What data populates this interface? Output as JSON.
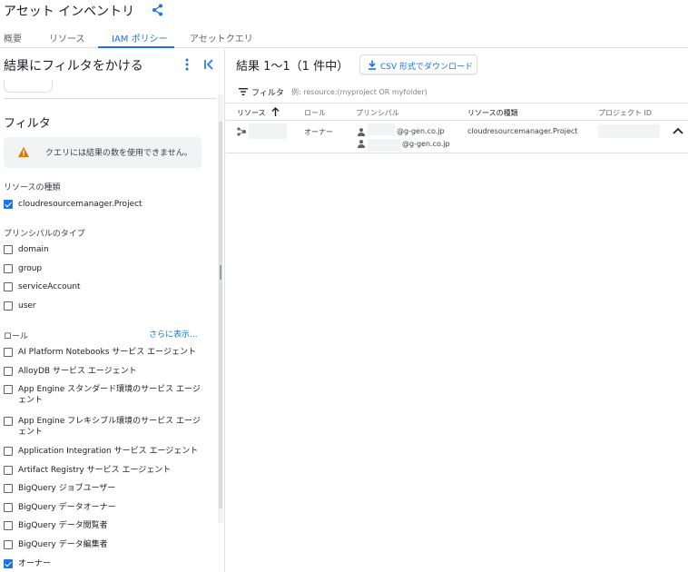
{
  "header": {
    "title": "アセット インベントリ"
  },
  "tabs": [
    {
      "label": "概要",
      "active": false
    },
    {
      "label": "リソース",
      "active": false
    },
    {
      "label": "IAM ポリシー",
      "active": true
    },
    {
      "label": "アセットクエリ",
      "active": false
    }
  ],
  "filter_panel": {
    "title": "結果にフィルタをかける",
    "filter_heading": "フィルタ",
    "warning": "クエリには結果の数を使用できません。",
    "resource_type": {
      "label": "リソースの種類",
      "options": [
        {
          "label": "cloudresourcemanager.Project",
          "checked": true
        }
      ]
    },
    "principal_type": {
      "label": "プリンシパルのタイプ",
      "options": [
        {
          "label": "domain",
          "checked": false
        },
        {
          "label": "group",
          "checked": false
        },
        {
          "label": "serviceAccount",
          "checked": false
        },
        {
          "label": "user",
          "checked": false
        }
      ]
    },
    "role": {
      "label": "ロール",
      "show_more": "さらに表示...",
      "options": [
        {
          "label": "AI Platform Notebooks サービス エージェント",
          "checked": false
        },
        {
          "label": "AlloyDB サービス エージェント",
          "checked": false
        },
        {
          "label": "App Engine スタンダード環境のサービス エージェント",
          "checked": false
        },
        {
          "label": "App Engine フレキシブル環境のサービス エージェント",
          "checked": false
        },
        {
          "label": "Application Integration サービス エージェント",
          "checked": false
        },
        {
          "label": "Artifact Registry サービス エージェント",
          "checked": false
        },
        {
          "label": "BigQuery ジョブユーザー",
          "checked": false
        },
        {
          "label": "BigQuery データオーナー",
          "checked": false
        },
        {
          "label": "BigQuery データ閲覧者",
          "checked": false
        },
        {
          "label": "BigQuery データ編集者",
          "checked": false
        },
        {
          "label": "オーナー",
          "checked": true
        }
      ]
    }
  },
  "results": {
    "title": "結果 1〜1（1 件中）",
    "download_label": "CSV 形式でダウンロード",
    "filter_label": "フィルタ",
    "filter_placeholder": "例: resource:(myproject OR myfolder)",
    "columns": [
      "リソース",
      "ロール",
      "プリンシパル",
      "リソースの種類",
      "プロジェクト ID"
    ],
    "rows": [
      {
        "role": "オーナー",
        "principals": [
          "@g-gen.co.jp",
          "@g-gen.co.jp"
        ],
        "resource_type": "cloudresourcemanager.Project"
      }
    ]
  },
  "colors": {
    "accent": "#1a73e8",
    "warning": "#e37400"
  }
}
